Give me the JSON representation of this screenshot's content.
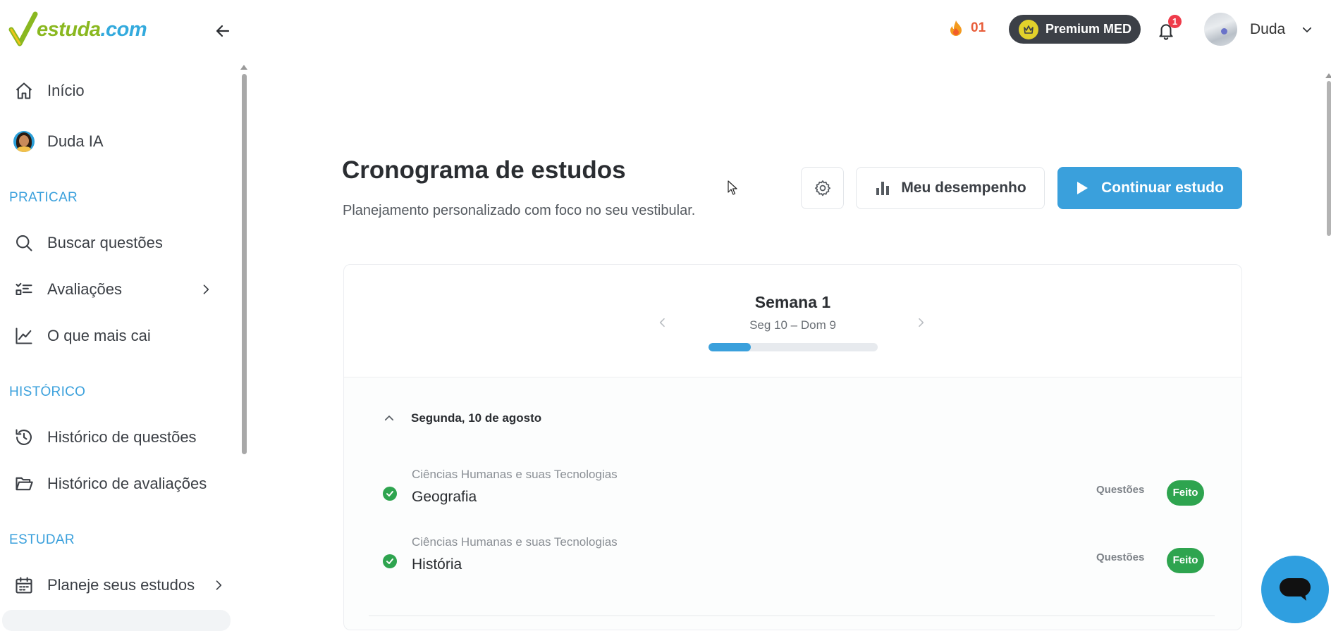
{
  "brand": {
    "logo_part1": "estuda",
    "logo_part2": ".com"
  },
  "sidebar": {
    "items": [
      {
        "label": "Início",
        "icon": "home-icon"
      },
      {
        "label": "Duda IA",
        "icon": "duda-avatar"
      }
    ],
    "sections": [
      {
        "title": "PRATICAR",
        "items": [
          {
            "label": "Buscar questões",
            "icon": "search-icon"
          },
          {
            "label": "Avaliações",
            "icon": "checklist-icon"
          },
          {
            "label": "O que mais cai",
            "icon": "trend-chart-icon"
          }
        ]
      },
      {
        "title": "HISTÓRICO",
        "items": [
          {
            "label": "Histórico de questões",
            "icon": "history-icon"
          },
          {
            "label": "Histórico de avaliações",
            "icon": "folder-open-icon"
          }
        ]
      },
      {
        "title": "ESTUDAR",
        "items": [
          {
            "label": "Planeje seus estudos",
            "icon": "calendar-icon"
          }
        ]
      }
    ]
  },
  "header": {
    "streak_count": "01",
    "premium_label": "Premium MED",
    "notification_count": "1",
    "user_name": "Duda"
  },
  "main": {
    "title": "Cronograma de estudos",
    "subtitle": "Planejamento personalizado com foco no seu vestibular.",
    "performance_label": "Meu desempenho",
    "continue_label": "Continuar estudo"
  },
  "week": {
    "title": "Semana 1",
    "range": "Seg 10 – Dom 9",
    "progress": 0.25
  },
  "day": {
    "label": "Segunda, 10 de agosto",
    "tasks": [
      {
        "area": "Ciências Humanas e suas Tecnologias",
        "subject": "Geografia",
        "type": "Questões",
        "status": "Feito"
      },
      {
        "area": "Ciências Humanas e suas Tecnologias",
        "subject": "História",
        "type": "Questões",
        "status": "Feito"
      }
    ]
  },
  "colors": {
    "accent": "#3aa0dc",
    "success": "#2ea44f",
    "streak": "#e85d3a",
    "premium_bg": "#3c4047"
  }
}
